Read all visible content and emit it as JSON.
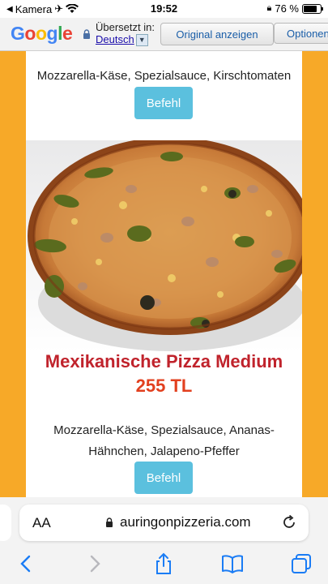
{
  "status_bar": {
    "back_app": "Kamera",
    "time": "19:52",
    "battery": "76 %"
  },
  "translate_bar": {
    "logo": [
      "G",
      "o",
      "o",
      "g",
      "l",
      "e"
    ],
    "translated_label": "Übersetzt in:",
    "language": "Deutsch",
    "show_original": "Original anzeigen",
    "options": "Optionen"
  },
  "menu": {
    "previous_description": "Mozzarella-Käse, Spezialsauce, Kirschtomaten",
    "order_label": "Befehl",
    "item": {
      "title": "Mexikanische Pizza Medium",
      "price": "255 TL",
      "description": "Mozzarella-Käse, Spezialsauce, Ananas-Hähnchen, Jalapeno-Pfeffer"
    }
  },
  "address_bar": {
    "text_size": "AA",
    "url": "auringonpizzeria.com"
  },
  "toolbar": {
    "icons": [
      "back-icon",
      "forward-icon",
      "share-icon",
      "bookmarks-icon",
      "tabs-icon"
    ]
  },
  "colors": {
    "page_bg": "#f7a928",
    "title_red": "#c0232c",
    "price_orange": "#e2401f",
    "button_blue": "#5bc0de",
    "ios_blue": "#1a7cf5"
  }
}
